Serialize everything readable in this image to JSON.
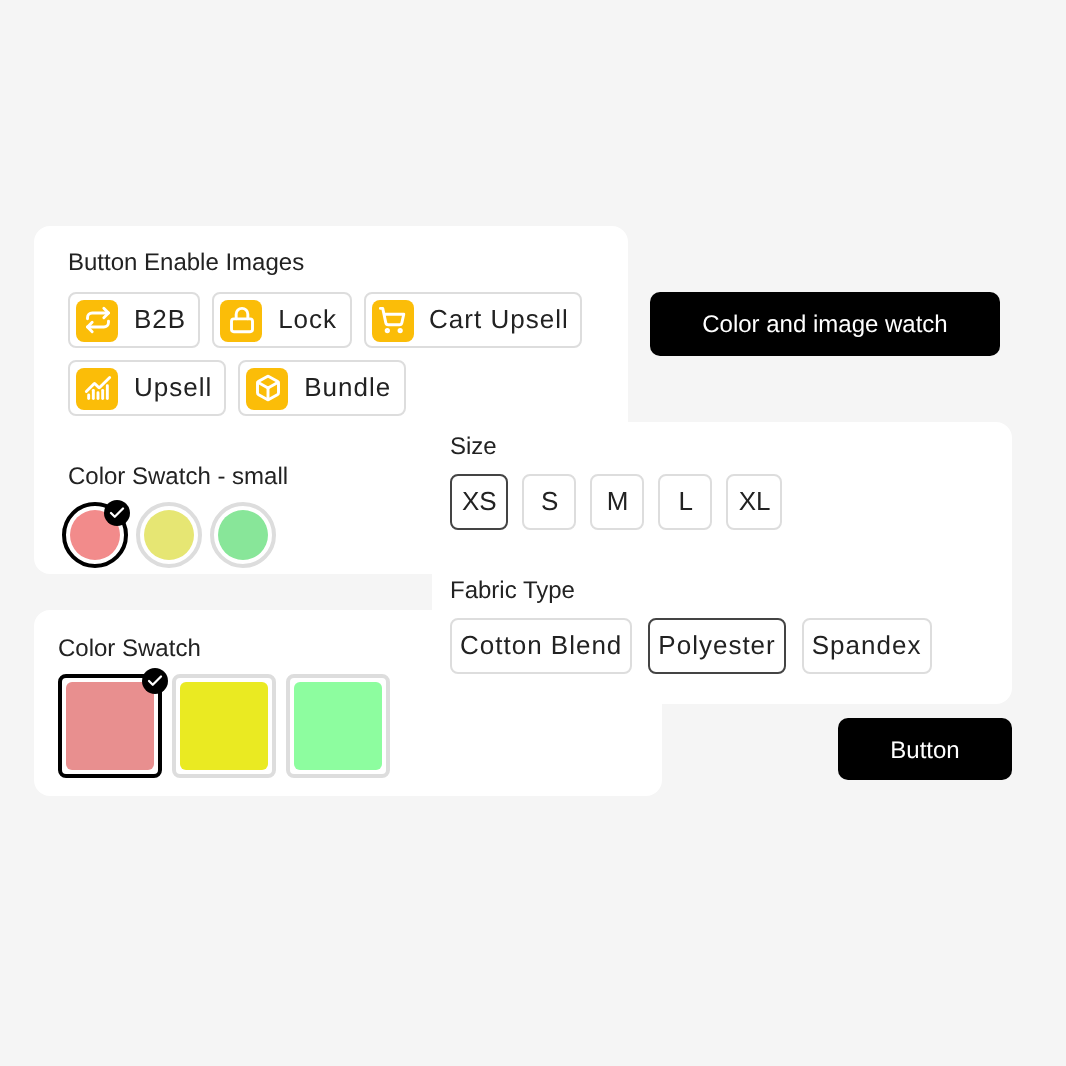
{
  "image_buttons": {
    "title": "Button Enable Images",
    "items": [
      {
        "label": "B2B",
        "kind": "exchange"
      },
      {
        "label": "Lock",
        "kind": "lock"
      },
      {
        "label": "Cart Upsell",
        "kind": "cart"
      },
      {
        "label": "Upsell",
        "kind": "chart"
      },
      {
        "label": "Bundle",
        "kind": "box"
      }
    ]
  },
  "small_swatch": {
    "title": "Color Swatch - small",
    "items": [
      {
        "color": "#f28b8b",
        "selected": true
      },
      {
        "color": "#e6e673",
        "selected": false
      },
      {
        "color": "#88e699",
        "selected": false
      }
    ]
  },
  "color_image_button": "Color and image watch",
  "size": {
    "title": "Size",
    "items": [
      {
        "label": "XS",
        "selected": true
      },
      {
        "label": "S",
        "selected": false
      },
      {
        "label": "M",
        "selected": false
      },
      {
        "label": "L",
        "selected": false
      },
      {
        "label": "XL",
        "selected": false
      }
    ]
  },
  "fabric": {
    "title": "Fabric Type",
    "items": [
      {
        "label": "Cotton Blend",
        "selected": false
      },
      {
        "label": "Polyester",
        "selected": true
      },
      {
        "label": "Spandex",
        "selected": false
      }
    ]
  },
  "swatch": {
    "title": "Color Swatch",
    "items": [
      {
        "color": "#e88f8f",
        "selected": true
      },
      {
        "color": "#eaea22",
        "selected": false
      },
      {
        "color": "#8dfd9f",
        "selected": false
      }
    ]
  },
  "button": "Button"
}
